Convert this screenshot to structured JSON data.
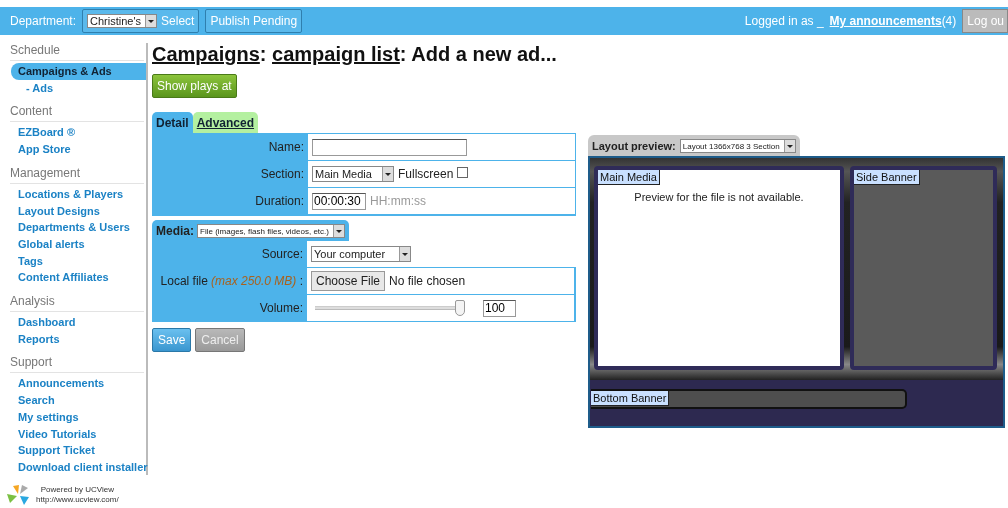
{
  "topbar": {
    "department_label": "Department:",
    "department_value": "Christine's",
    "select_button": "Select",
    "publish_button": "Publish Pending",
    "logged_in": "Logged in as _",
    "announcements_link": "My announcements",
    "announcements_count": "(4)",
    "logout_button": "Log ou"
  },
  "sidebar": {
    "sections": [
      {
        "title": "Schedule",
        "items": [
          {
            "label": "Campaigns & Ads",
            "selected": true,
            "children": [
              {
                "label": "- Ads",
                "selected": false
              }
            ]
          }
        ]
      },
      {
        "title": "Content",
        "items": [
          {
            "label": "EZBoard ®",
            "selected": false
          },
          {
            "label": "App Store",
            "selected": false
          }
        ]
      },
      {
        "title": "Management",
        "items": [
          {
            "label": "Locations & Players",
            "selected": false
          },
          {
            "label": "Layout Designs",
            "selected": false
          },
          {
            "label": "Departments & Users",
            "selected": false
          },
          {
            "label": "Global alerts",
            "selected": false
          },
          {
            "label": "Tags",
            "selected": false
          },
          {
            "label": "Content Affiliates",
            "selected": false
          }
        ]
      },
      {
        "title": "Analysis",
        "items": [
          {
            "label": "Dashboard",
            "selected": false
          },
          {
            "label": "Reports",
            "selected": false
          }
        ]
      },
      {
        "title": "Support",
        "items": [
          {
            "label": "Announcements",
            "selected": false
          },
          {
            "label": "Search",
            "selected": false
          },
          {
            "label": "My settings",
            "selected": false
          },
          {
            "label": "Video Tutorials",
            "selected": false
          },
          {
            "label": "Support Ticket",
            "selected": false
          },
          {
            "label": "Download client installer",
            "selected": false
          }
        ]
      }
    ]
  },
  "footer": {
    "powered": "Powered by UCView",
    "url": "http://www.ucview.com/"
  },
  "heading": {
    "separator": ":",
    "parts": [
      {
        "label": "Campaigns",
        "kind": "link"
      },
      {
        "label": "campaign list",
        "kind": "link"
      },
      {
        "label": "Add a new ad...",
        "kind": "text"
      }
    ]
  },
  "show_plays_button": "Show plays at",
  "tabs": [
    {
      "label": "Detail",
      "selected": true
    },
    {
      "label": "Advanced",
      "selected": false
    }
  ],
  "form": {
    "fields": [
      {
        "label": "Name:",
        "kind": "text"
      },
      {
        "label": "Section:",
        "kind": "select",
        "value": "Main Media",
        "checkbox_label": "Fullscreen",
        "checked": false
      },
      {
        "label": "Duration:",
        "kind": "text",
        "value": "00:00:30",
        "hint": "HH:mm:ss"
      }
    ]
  },
  "media": {
    "label": "Media:",
    "value": "File (images, flash files, videos, etc.)",
    "fields": [
      {
        "label": "Source:",
        "kind": "select",
        "value": "Your computer"
      },
      {
        "label": "Local file",
        "note": "(max 250.0 MB)",
        "suffix": ":",
        "kind": "file",
        "button": "Choose File",
        "status": "No file chosen"
      },
      {
        "label": "Volume:",
        "kind": "slider",
        "level": 1,
        "value": "100"
      }
    ]
  },
  "actions": [
    {
      "label": "Save",
      "disabled": false
    },
    {
      "label": "Cancel",
      "disabled": true
    }
  ],
  "preview": {
    "label": "Layout preview:",
    "layout": "Layout 1366x768 3 Section",
    "regions": [
      {
        "label": "Main Media",
        "kind": "main",
        "message": "Preview for the file is not available."
      },
      {
        "label": "Side Banner",
        "kind": "side"
      },
      {
        "label": "Bottom Banner",
        "kind": "bottom"
      }
    ]
  }
}
